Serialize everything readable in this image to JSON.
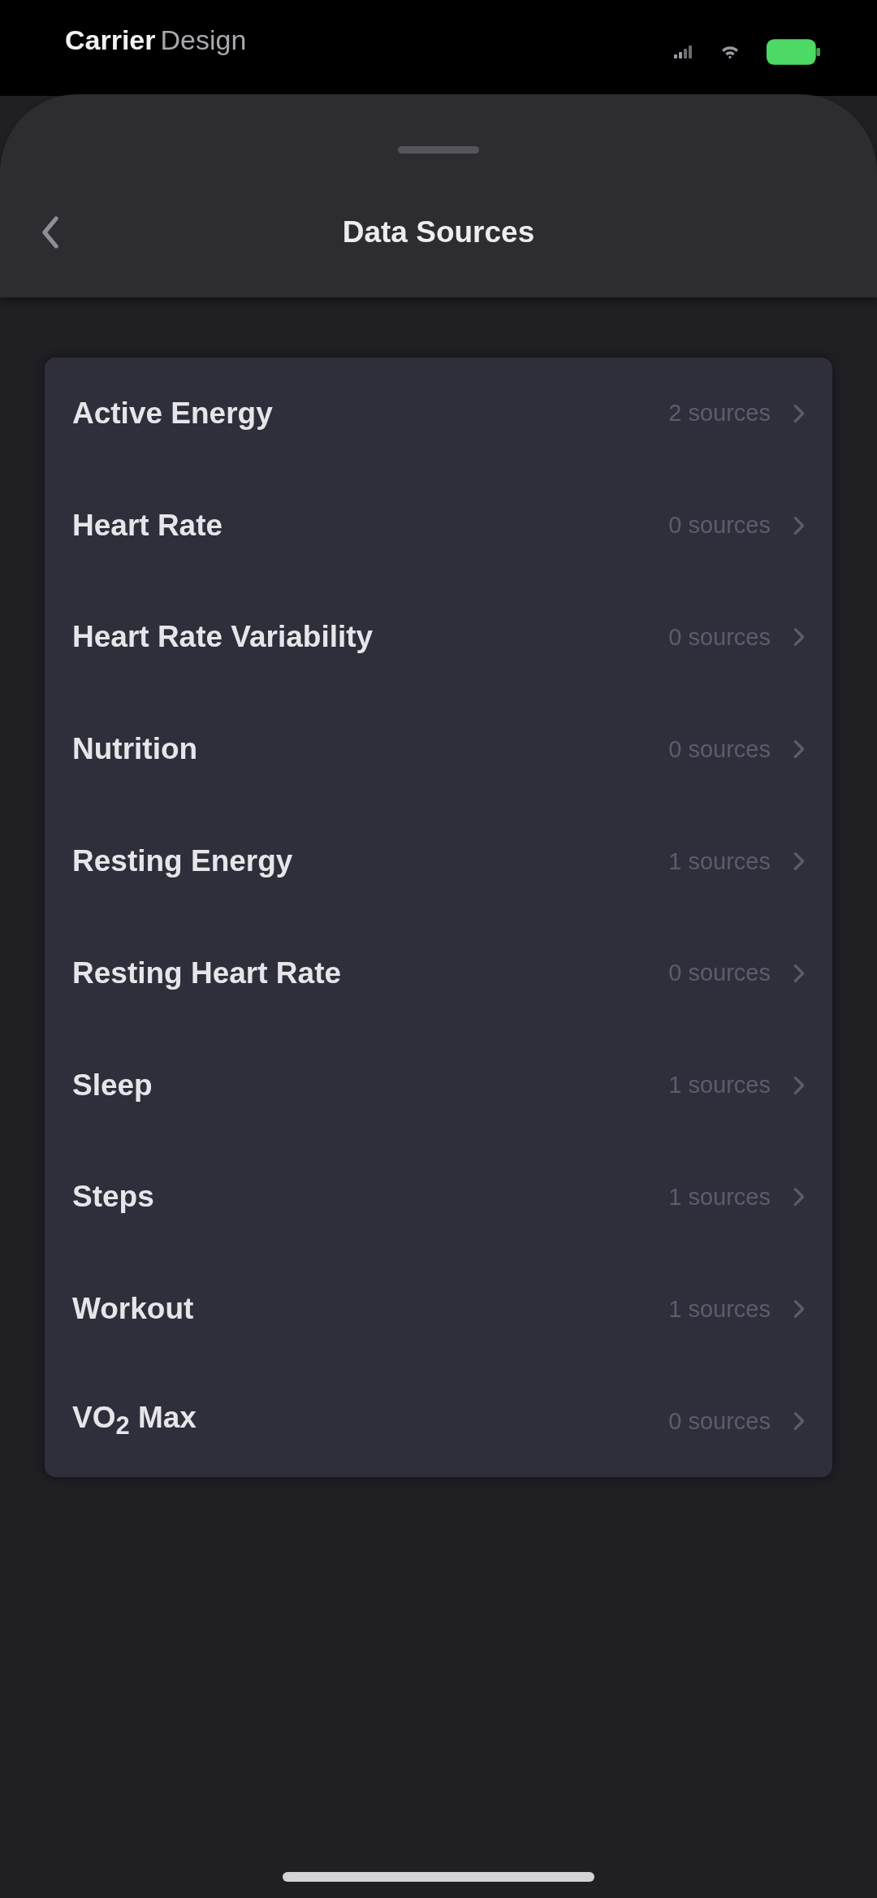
{
  "status_bar": {
    "carrier": "Carrier",
    "network": "Design",
    "charging": true
  },
  "nav": {
    "title": "Data Sources"
  },
  "sources": [
    {
      "label": "Active Energy",
      "detail": "2 sources"
    },
    {
      "label": "Heart Rate",
      "detail": "0 sources"
    },
    {
      "label": "Heart Rate Variability",
      "detail": "0 sources"
    },
    {
      "label": "Nutrition",
      "detail": "0 sources"
    },
    {
      "label": "Resting Energy",
      "detail": "1 sources"
    },
    {
      "label": "Resting Heart Rate",
      "detail": "0 sources"
    },
    {
      "label": "Sleep",
      "detail": "1 sources"
    },
    {
      "label": "Steps",
      "detail": "1 sources"
    },
    {
      "label": "Workout",
      "detail": "1 sources"
    },
    {
      "label": "VO$_{2}$ Max",
      "detail": "0 sources"
    }
  ]
}
